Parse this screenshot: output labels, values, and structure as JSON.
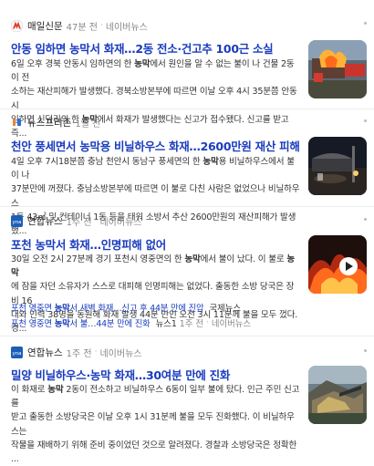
{
  "results": [
    {
      "source": "매일신문",
      "time": "47분 전",
      "portal": "네이버뉴스",
      "title": [
        "안동 임하면 ",
        "농막",
        "서 화재…2동 전소·건고추 100근 소실"
      ],
      "snippet": [
        [
          "6일 오후 경북 안동시 임하면의 한 ",
          "농막",
          "에서 원인을 알 수 없는 불이 나 건물 2동이 전"
        ],
        [
          "소하는 재산피해가 발생했다. 경북소방본부에 따르면 이날 오후 4시 35분쯤 안동시"
        ],
        [
          "임하면 신덕리의 한 ",
          "농막",
          "에서 화재가 발생했다는 신고가 접수됐다. 신고를 받고 즉..."
        ]
      ],
      "logo_color": "#e23a2e"
    },
    {
      "source": "뉴스프리존",
      "time": "1일 전",
      "portal": "",
      "title": [
        "천안 풍세면서 ",
        "농막",
        "용 비닐하우스 화재…2600만원 재산 피해"
      ],
      "snippet": [
        [
          "4일 오후 7시18분쯤 충남 천안시 동남구 풍세면의 한 ",
          "농막",
          "용 비닐하우스에서 불이 나"
        ],
        [
          "37분만에 꺼졌다. 충남소방본부에 따르면 이 불로 다친 사람은 없었으나 비닐하우스"
        ],
        [
          "1동 43㎡ 및 컨테이너 1동 등을 태워 소방서 추산 2600만원의 재산피해가 발생했..."
        ]
      ],
      "logo_color": "#2b6fd6"
    },
    {
      "source": "연합뉴스",
      "time": "1주 전",
      "portal": "네이버뉴스",
      "title": [
        "포천 ",
        "농막",
        "서 화재…인명피해 없어"
      ],
      "snippet": [
        [
          "30일 오전 2시 27분께 경기 포천시 영중면의 한 ",
          "농막",
          "에서 불이 났다. 이 불로 ",
          "농막"
        ],
        [
          "에 잠을 자던 소유자가 스스로 대피해 인명피해는 없었다. 출동한 소방 당국은 장비 16"
        ],
        [
          "대와 인력 38명을 동원해 화재 발생 44분 만인 오전 3시 11분께 불을 모두 껐다. 경..."
        ]
      ],
      "related": [
        {
          "title": [
            "포천 영중면 ",
            "농막",
            "서 새벽 화재…신고 후 44분 만에 진압"
          ],
          "source": "국제뉴스",
          "time": "",
          "portal": ""
        },
        {
          "title": [
            "포천 영중면 ",
            "농막",
            "서 불…44분 만에 진화"
          ],
          "source": "뉴스1",
          "time": "1주 전",
          "portal": "네이버뉴스"
        }
      ],
      "logo_color": "#1c5fb8"
    },
    {
      "source": "연합뉴스",
      "time": "1주 전",
      "portal": "네이버뉴스",
      "title": [
        "밀양 비닐하우스·",
        "농막",
        " 화재…30여분 만에 진화"
      ],
      "snippet": [
        [
          "이 화재로 ",
          "농막",
          " 2동이 전소하고 비닐하우스 6동이 일부 불에 탔다. 인근 주민 신고를"
        ],
        [
          "받고 출동한 소방당국은 이날 오후 1시 31분께 불을 모두 진화했다. 이 비닐하우스는"
        ],
        [
          "작물을 재배하기 위해 준비 중이었던 것으로 알려졌다. 경찰과 소방당국은 정확한 ..."
        ]
      ],
      "logo_color": "#1c5fb8"
    }
  ]
}
